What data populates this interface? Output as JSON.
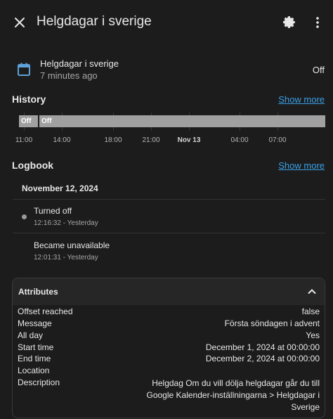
{
  "header": {
    "title": "Helgdagar i sverige"
  },
  "entity": {
    "name": "Helgdagar i sverige",
    "last_changed": "7 minutes ago",
    "state": "Off"
  },
  "history": {
    "title": "History",
    "show_more": "Show more",
    "bars": [
      {
        "label": "Off",
        "start_fraction": 0.02,
        "end_fraction": 0.08
      },
      {
        "label": "Off",
        "start_fraction": 0.085,
        "end_fraction": 1.0
      }
    ],
    "ticks": [
      {
        "label": "11:00",
        "fraction": 0.035,
        "bold": false
      },
      {
        "label": "14:00",
        "fraction": 0.157,
        "bold": false
      },
      {
        "label": "18:00",
        "fraction": 0.322,
        "bold": false
      },
      {
        "label": "21:00",
        "fraction": 0.442,
        "bold": false
      },
      {
        "label": "Nov 13",
        "fraction": 0.563,
        "bold": true
      },
      {
        "label": "04:00",
        "fraction": 0.726,
        "bold": false
      },
      {
        "label": "07:00",
        "fraction": 0.847,
        "bold": false
      }
    ]
  },
  "logbook": {
    "title": "Logbook",
    "show_more": "Show more",
    "date": "November 12, 2024",
    "entries": [
      {
        "text": "Turned off",
        "sub": "12:16:32 - Yesterday",
        "dot": true
      },
      {
        "text": "Became unavailable",
        "sub": "12:01:31 - Yesterday",
        "dot": false
      }
    ]
  },
  "attributes": {
    "title": "Attributes",
    "rows": [
      {
        "key": "Offset reached",
        "value": "false"
      },
      {
        "key": "Message",
        "value": "Första söndagen i advent"
      },
      {
        "key": "All day",
        "value": "Yes"
      },
      {
        "key": "Start time",
        "value": "December 1, 2024 at 00:00:00"
      },
      {
        "key": "End time",
        "value": "December 2, 2024 at 00:00:00"
      },
      {
        "key": "Location",
        "value": ""
      },
      {
        "key": "Description",
        "value": "Helgdag Om du vill dölja helgdagar går du till Google Kalender-inställningarna > Helgdagar i Sverige"
      }
    ]
  },
  "colors": {
    "background": "#1c1c1c",
    "accent": "#3aa0e8",
    "bar": "#a0a0a0",
    "icon_blue": "#5ea0d8"
  }
}
